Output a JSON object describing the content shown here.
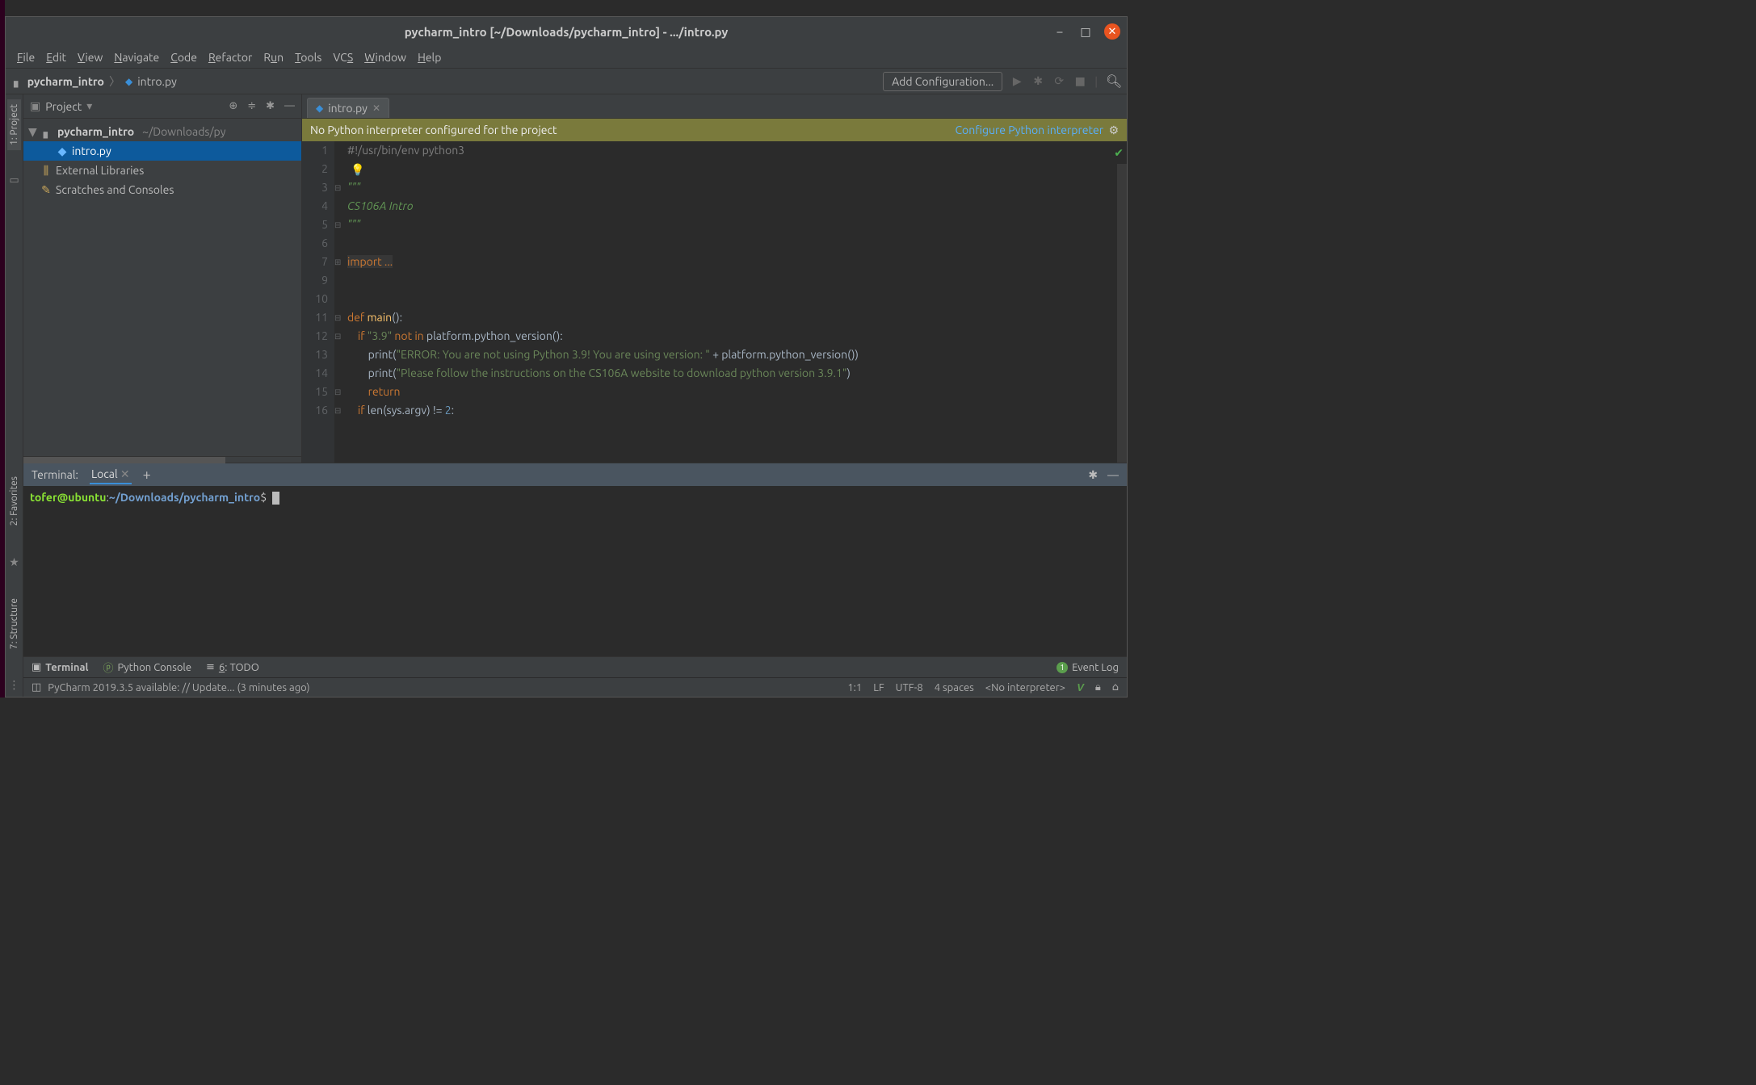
{
  "title": "pycharm_intro [~/Downloads/pycharm_intro] - .../intro.py",
  "menu": {
    "file": "File",
    "edit": "Edit",
    "view": "View",
    "navigate": "Navigate",
    "code": "Code",
    "refactor": "Refactor",
    "run": "Run",
    "tools": "Tools",
    "vcs": "VCS",
    "window": "Window",
    "help": "Help"
  },
  "breadcrumb": {
    "root": "pycharm_intro",
    "file": "intro.py"
  },
  "toolbar": {
    "add_config": "Add Configuration..."
  },
  "left_tabs": {
    "project": "1: Project",
    "favorites": "2: Favorites",
    "structure": "7: Structure"
  },
  "project_header": {
    "label": "Project"
  },
  "tree": {
    "root": "pycharm_intro",
    "root_path": "~/Downloads/py",
    "file": "intro.py",
    "ext_lib": "External Libraries",
    "scratch": "Scratches and Consoles"
  },
  "tab": {
    "name": "intro.py"
  },
  "banner": {
    "msg": "No Python interpreter configured for the project",
    "link": "Configure Python interpreter"
  },
  "code": {
    "lines": [
      "1",
      "2",
      "3",
      "4",
      "5",
      "6",
      "7",
      "9",
      "10",
      "11",
      "12",
      "13",
      "14",
      "15",
      "16"
    ],
    "l1": "#!/usr/bin/env python3",
    "l3": "\"\"\"",
    "l4": "CS106A Intro",
    "l5": "\"\"\"",
    "l7": "import ...",
    "l11_def": "def ",
    "l11_fn": "main",
    "l11_rest": "():",
    "l12_if": "    if ",
    "l12_str": "\"3.9\"",
    "l12_notin": " not in ",
    "l12_call": "platform.python_version():",
    "l13_pre": "        print(",
    "l13_str": "\"ERROR: You are not using Python 3.9! You are using version: \"",
    "l13_post": " + platform.python_version())",
    "l14_pre": "        print(",
    "l14_str": "\"Please follow the instructions on the CS106A website to download python version 3.9.1\"",
    "l14_post": ")",
    "l15": "        return",
    "l16_if": "    if ",
    "l16_call": "len(sys.argv) != ",
    "l16_num": "2",
    "l16_colon": ":"
  },
  "terminal": {
    "title": "Terminal:",
    "tab": "Local",
    "user": "tofer@ubuntu",
    "colon": ":",
    "path": "~/Downloads/pycharm_intro",
    "dollar": "$"
  },
  "bottom": {
    "terminal": "Terminal",
    "python_console": "Python Console",
    "todo": "6: TODO",
    "event_log": "Event Log"
  },
  "status": {
    "update": "PyCharm 2019.3.5 available: // Update... (3 minutes ago)",
    "pos": "1:1",
    "lf": "LF",
    "enc": "UTF-8",
    "indent": "4 spaces",
    "interp": "<No interpreter>"
  }
}
